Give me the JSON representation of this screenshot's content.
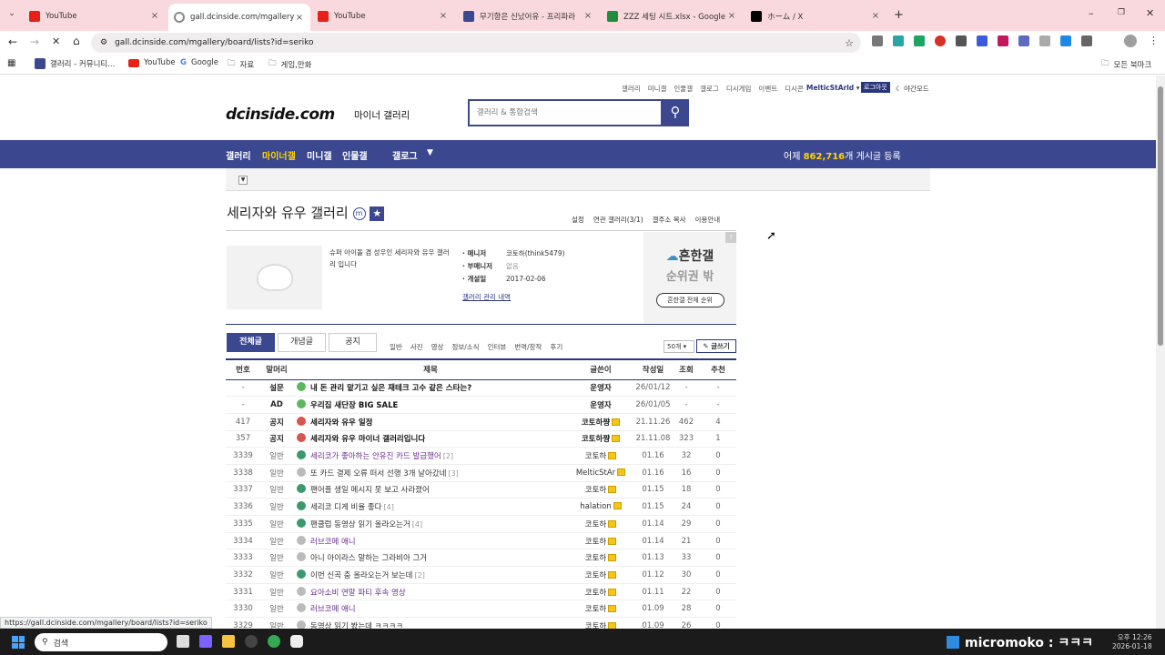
{
  "browser": {
    "tabs": [
      {
        "title": "YouTube",
        "icon": "youtube-icon",
        "color": "#e62117"
      },
      {
        "title": "gall.dcinside.com/mgallery/bo",
        "icon": "loading-icon",
        "color": "#888888"
      },
      {
        "title": "YouTube",
        "icon": "youtube-icon",
        "color": "#e62117"
      },
      {
        "title": "무기항은 신났어유 - 프리파라",
        "icon": "site-icon",
        "color": "#3b4890"
      },
      {
        "title": "ZZZ 세팅 시트.xlsx - Google S",
        "icon": "sheets-icon",
        "color": "#1e8e3e"
      },
      {
        "title": "ホーム / X",
        "icon": "x-icon",
        "color": "#000000"
      }
    ],
    "address": "gall.dcinside.com/mgallery/board/lists?id=seriko",
    "bookmarks": [
      {
        "label": "갤러리 - 커뮤니티...",
        "icon": "dc-icon"
      },
      {
        "label": "YouTube",
        "icon": "youtube-icon"
      },
      {
        "label": "Google",
        "icon": "google-icon"
      },
      {
        "label": "자료",
        "icon": "folder-icon"
      },
      {
        "label": "게임,만화",
        "icon": "folder-icon"
      }
    ],
    "bookmarks_all": "모든 북마크",
    "status_url": "https://gall.dcinside.com/mgallery/board/lists?id=seriko"
  },
  "site": {
    "top_links": [
      "갤러리",
      "미니갤",
      "인물갤",
      "갤로그",
      "디시게임",
      "이벤트",
      "디시콘"
    ],
    "user": "MelticStArld",
    "logout": "로그아웃",
    "night_mode": "야간모드",
    "logo": "dcinside.com",
    "logo_sub": "마이너 갤러리",
    "search_placeholder": "갤러리 & 통합검색",
    "nav": [
      "갤러리",
      "마이너갤",
      "미니갤",
      "인물갤",
      "갤로그"
    ],
    "nav_stats_prefix": "어제",
    "nav_stats_count": "862,716",
    "nav_stats_suffix": "개 게시글 등록",
    "brand_color": "#3b4890",
    "active_nav_color": "#ffd400"
  },
  "gallery": {
    "title": "세리자와 유우 갤러리",
    "links": [
      "설정",
      "연관 갤러리(3/1)",
      "갤주소 복사",
      "이용안내"
    ],
    "description": "슈퍼 아이돌 겸 성우인 세리자와 유우 갤러리 입니다",
    "manager_label": "· 매니저",
    "manager": "코토하(think5479)",
    "submanager_label": "· 부매니저",
    "submanager": "없음",
    "opened_label": "· 개설일",
    "opened": "2017-02-06",
    "admin_log": "갤러리 관리 내역",
    "ranking_title": "흔한갤",
    "ranking_sub": "순위권 밖",
    "ranking_btn": "흔한갤 전체 순위"
  },
  "tabs": {
    "main": [
      "전체글",
      "개념글",
      "공지"
    ],
    "sub": [
      "일반",
      "사진",
      "영상",
      "정보/소식",
      "인터뷰",
      "번역/창작",
      "후기"
    ],
    "per_page": "50개",
    "write": "글쓰기"
  },
  "table": {
    "headers": [
      "번호",
      "말머리",
      "제목",
      "글쓴이",
      "작성일",
      "조회",
      "추천"
    ],
    "rows": [
      {
        "no": "-",
        "head": "설문",
        "title": "내 돈 관리 맡기고 싶은 재테크 고수 같은 스타는?",
        "comments": "",
        "writer": "운영자",
        "date": "26/01/12",
        "views": "-",
        "recs": "-",
        "bold": true,
        "icon": "poll-icon",
        "iconColor": "#5cb85c",
        "titleColor": "#111111"
      },
      {
        "no": "-",
        "head": "AD",
        "title": "우리집 새단장 BIG SALE",
        "comments": "",
        "writer": "운영자",
        "date": "26/01/05",
        "views": "-",
        "recs": "-",
        "bold": true,
        "icon": "ad-icon",
        "iconColor": "#5cb85c",
        "titleColor": "#111111"
      },
      {
        "no": "417",
        "head": "공지",
        "title": "세리자와 유우 일정",
        "comments": "",
        "writer": "코토하쨩",
        "date": "21.11.26",
        "views": "462",
        "recs": "4",
        "bold": true,
        "icon": "notice-icon",
        "iconColor": "#d9534f",
        "titleColor": "#111111"
      },
      {
        "no": "357",
        "head": "공지",
        "title": "세리자와 유우 마이너 갤러리입니다",
        "comments": "",
        "writer": "코토하쨩",
        "date": "21.11.08",
        "views": "323",
        "recs": "1",
        "bold": true,
        "icon": "notice-icon",
        "iconColor": "#d9534f",
        "titleColor": "#111111"
      },
      {
        "no": "3339",
        "head": "일반",
        "title": "세리코가 좋아하는 안유진 카드 발급했어",
        "comments": "[2]",
        "writer": "코토하",
        "date": "01.16",
        "views": "32",
        "recs": "0",
        "bold": false,
        "icon": "image-icon",
        "iconColor": "#3a9a6e",
        "titleColor": "#6a2c91"
      },
      {
        "no": "3338",
        "head": "일반",
        "title": "또 카드 결제 오류 떠서 선행 3개 날아갔네",
        "comments": "[3]",
        "writer": "MelticStAr",
        "date": "01.16",
        "views": "16",
        "recs": "0",
        "bold": false,
        "icon": "text-icon",
        "iconColor": "#bbbbbb",
        "titleColor": "#333333"
      },
      {
        "no": "3337",
        "head": "일반",
        "title": "팬어플 생일 메시지 못 보고 사라졌어",
        "comments": "",
        "writer": "코토하",
        "date": "01.15",
        "views": "18",
        "recs": "0",
        "bold": false,
        "icon": "image-icon",
        "iconColor": "#3a9a6e",
        "titleColor": "#333333"
      },
      {
        "no": "3336",
        "head": "일반",
        "title": "세리코 디게 비율 좋다",
        "comments": "[4]",
        "writer": "halation",
        "date": "01.15",
        "views": "24",
        "recs": "0",
        "bold": false,
        "icon": "image-icon",
        "iconColor": "#3a9a6e",
        "titleColor": "#333333"
      },
      {
        "no": "3335",
        "head": "일반",
        "title": "팬클럽 동영상 읽기 올라오는거",
        "comments": "[4]",
        "writer": "코토하",
        "date": "01.14",
        "views": "29",
        "recs": "0",
        "bold": false,
        "icon": "image-icon",
        "iconColor": "#3a9a6e",
        "titleColor": "#333333"
      },
      {
        "no": "3334",
        "head": "일반",
        "title": "러브코메 애니",
        "comments": "",
        "writer": "코토하",
        "date": "01.14",
        "views": "21",
        "recs": "0",
        "bold": false,
        "icon": "text-icon",
        "iconColor": "#bbbbbb",
        "titleColor": "#6a2c91"
      },
      {
        "no": "3333",
        "head": "일반",
        "title": "아니 아이라스 말하는 그라비아 그거",
        "comments": "",
        "writer": "코토하",
        "date": "01.13",
        "views": "33",
        "recs": "0",
        "bold": false,
        "icon": "text-icon",
        "iconColor": "#bbbbbb",
        "titleColor": "#333333"
      },
      {
        "no": "3332",
        "head": "일반",
        "title": "이번 신곡 춤 올라오는거 보는데",
        "comments": "[2]",
        "writer": "코토하",
        "date": "01.12",
        "views": "30",
        "recs": "0",
        "bold": false,
        "icon": "image-icon",
        "iconColor": "#3a9a6e",
        "titleColor": "#333333"
      },
      {
        "no": "3331",
        "head": "일반",
        "title": "요아소비 연말 파티 후속 영상",
        "comments": "",
        "writer": "코토하",
        "date": "01.11",
        "views": "22",
        "recs": "0",
        "bold": false,
        "icon": "text-icon",
        "iconColor": "#bbbbbb",
        "titleColor": "#6a2c91"
      },
      {
        "no": "3330",
        "head": "일반",
        "title": "러브코메 애니",
        "comments": "",
        "writer": "코토하",
        "date": "01.09",
        "views": "28",
        "recs": "0",
        "bold": false,
        "icon": "text-icon",
        "iconColor": "#bbbbbb",
        "titleColor": "#6a2c91"
      },
      {
        "no": "3329",
        "head": "일반",
        "title": "동영상 읽기 봤는데 ㅋㅋㅋㅋ",
        "comments": "",
        "writer": "코토하",
        "date": "01.09",
        "views": "26",
        "recs": "0",
        "bold": false,
        "icon": "text-icon",
        "iconColor": "#bbbbbb",
        "titleColor": "#333333"
      }
    ]
  },
  "taskbar": {
    "search": "검색",
    "overlay": "micromoko : ㅋㅋㅋ",
    "time": "오후 12:26",
    "date": "2026-01-18"
  }
}
